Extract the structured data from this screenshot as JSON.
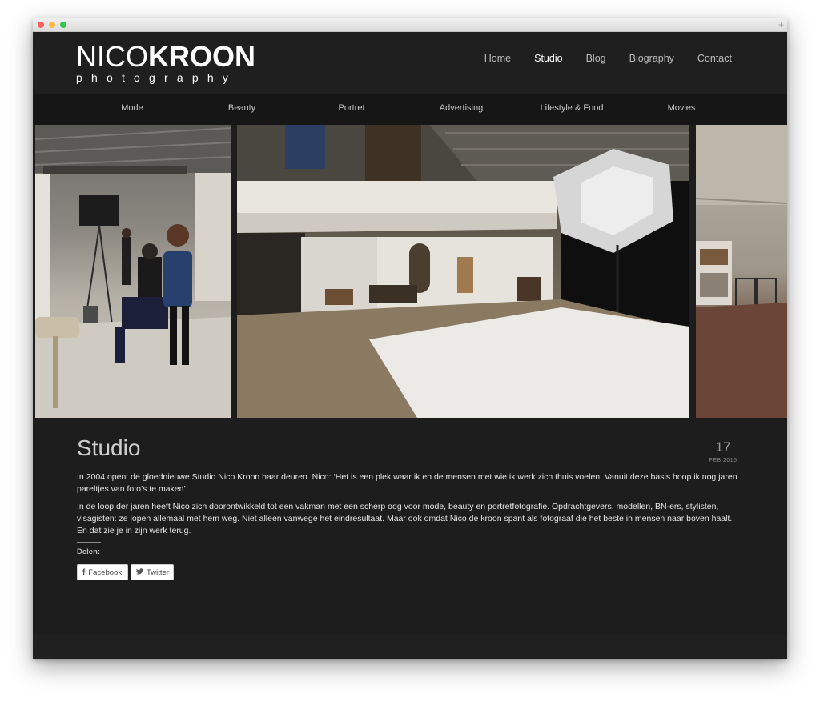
{
  "logo": {
    "part1": "NICO",
    "part2": "KROON",
    "sub": "photography"
  },
  "topnav": [
    {
      "label": "Home",
      "active": false
    },
    {
      "label": "Studio",
      "active": true
    },
    {
      "label": "Blog",
      "active": false
    },
    {
      "label": "Biography",
      "active": false
    },
    {
      "label": "Contact",
      "active": false
    }
  ],
  "subnav": [
    "Mode",
    "Beauty",
    "Portret",
    "Advertising",
    "Lifestyle & Food",
    "Movies"
  ],
  "post": {
    "title": "Studio",
    "day": "17",
    "month_year": "FEB 2015",
    "paragraphs": [
      "In 2004 opent de gloednieuwe Studio Nico Kroon haar deuren. Nico: ‘Het is een plek waar ik en de mensen met wie ik werk zich thuis voelen. Vanuit deze basis hoop ik nog jaren pareltjes van foto’s te maken’.",
      "In de loop der jaren heeft Nico zich doorontwikkeld tot een vakman met een scherp oog voor mode, beauty en portretfotografie. Opdrachtgevers, modellen, BN-ers, stylisten, visagisten: ze lopen allemaal met hem weg. Niet alleen vanwege het eindresultaat. Maar ook omdat Nico de kroon spant als fotograaf die het beste in mensen naar boven haalt. En dat zie je in zijn werk terug."
    ],
    "share_label": "Delen:",
    "facebook_label": "Facebook",
    "twitter_label": "Twitter"
  },
  "colors": {
    "background": "#1d1d1d",
    "accent": "#ffffff"
  }
}
